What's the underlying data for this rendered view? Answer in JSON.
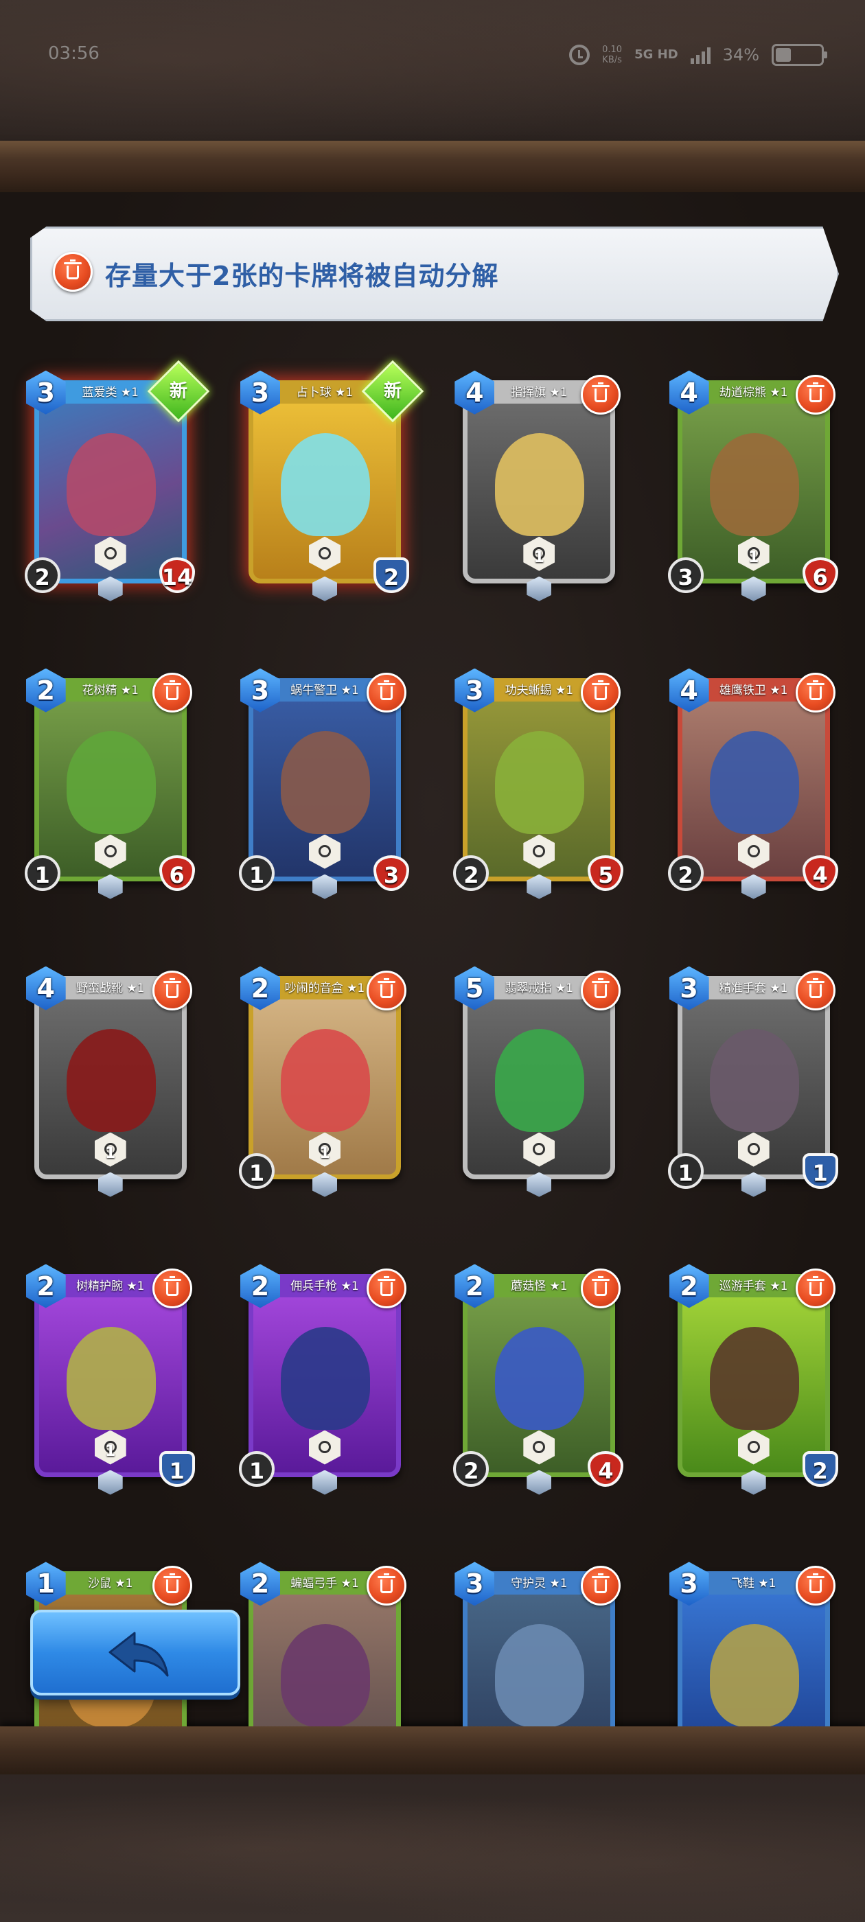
{
  "status_bar": {
    "time": "03:56",
    "net_speed_value": "0.10",
    "net_speed_unit": "KB/s",
    "net_type": "5G HD",
    "battery": "34%",
    "battery_level": 0.34
  },
  "notice": {
    "text": "存量大于2张的卡牌将被自动分解"
  },
  "cards": [
    {
      "name": "蓝爱类 ★1",
      "cost": "3",
      "attack": "2",
      "health": "14",
      "new": "新"
    },
    {
      "name": "占卜球 ★1",
      "cost": "3",
      "defense": "2",
      "new": "新"
    },
    {
      "name": "指挥旗 ★1",
      "cost": "4",
      "icon_value": "1"
    },
    {
      "name": "劫道棕熊 ★1",
      "cost": "4",
      "icon_value": "1",
      "attack": "3",
      "health": "6"
    },
    {
      "name": "花树精 ★1",
      "cost": "2",
      "attack": "1",
      "health": "6"
    },
    {
      "name": "蜗牛警卫 ★1",
      "cost": "3",
      "attack": "1",
      "health": "3"
    },
    {
      "name": "功夫蜥蜴 ★1",
      "cost": "3",
      "attack": "2",
      "health": "5"
    },
    {
      "name": "雄鹰铁卫 ★1",
      "cost": "4",
      "attack": "2",
      "health": "4"
    },
    {
      "name": "野蛮战靴 ★1",
      "cost": "4",
      "icon_value": "1"
    },
    {
      "name": "吵闹的音盒 ★1",
      "cost": "2",
      "icon_value": "1",
      "attack": "1"
    },
    {
      "name": "翡翠戒指 ★1",
      "cost": "5"
    },
    {
      "name": "精准手套 ★1",
      "cost": "3",
      "attack": "1",
      "defense": "1"
    },
    {
      "name": "树精护腕 ★1",
      "cost": "2",
      "icon_value": "1",
      "defense": "1"
    },
    {
      "name": "佣兵手枪 ★1",
      "cost": "2",
      "attack": "1"
    },
    {
      "name": "蘑菇怪 ★1",
      "cost": "2",
      "attack": "2",
      "health": "4"
    },
    {
      "name": "巡游手套 ★1",
      "cost": "2",
      "defense": "2"
    },
    {
      "name": "沙鼠 ★1",
      "cost": "1"
    },
    {
      "name": "蝙蝠弓手 ★1",
      "cost": "2"
    },
    {
      "name": "守护灵 ★1",
      "cost": "3"
    },
    {
      "name": "飞鞋 ★1",
      "cost": "3"
    }
  ],
  "icons": {
    "trash": "trash-icon",
    "back": "back-arrow-icon",
    "alarm": "alarm-icon",
    "signal": "signal-icon",
    "battery": "battery-icon"
  }
}
